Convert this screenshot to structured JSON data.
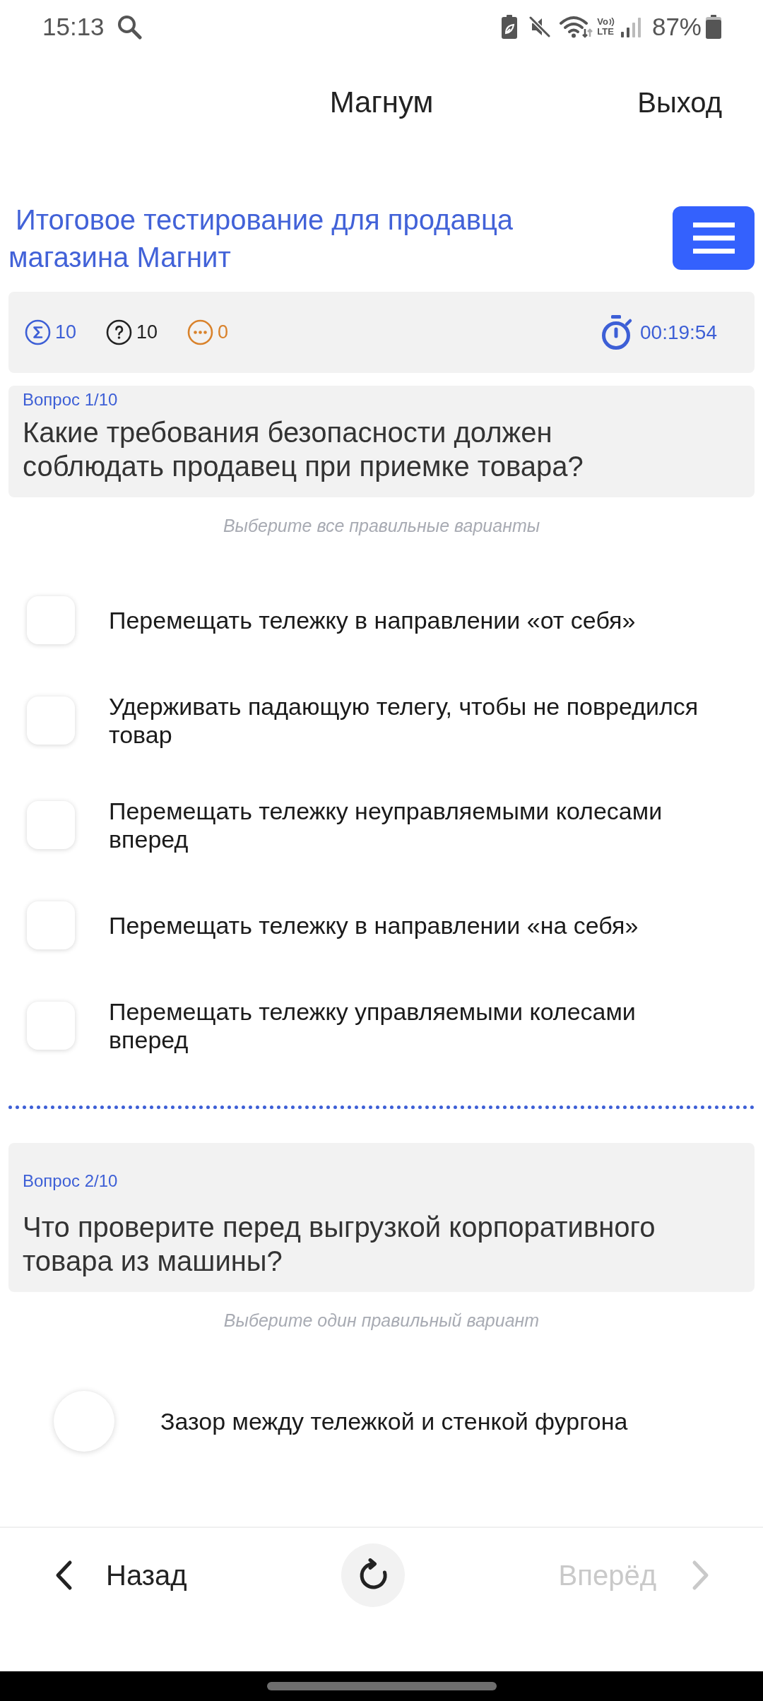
{
  "status_bar": {
    "time": "15:13",
    "volte": [
      "Vo",
      "LTE"
    ],
    "battery": "87%"
  },
  "header": {
    "title": "Магнум",
    "exit": "Выход"
  },
  "test": {
    "title": "Итоговое тестирование для продавца магазина Магнит"
  },
  "stats": {
    "items": [
      {
        "kind": "total",
        "value": "10",
        "color": "#3d5fd6"
      },
      {
        "kind": "questions",
        "value": "10",
        "color": "#222222"
      },
      {
        "kind": "skipped",
        "value": "0",
        "color": "#d9822b"
      }
    ],
    "timer": "00:19:54"
  },
  "questions": [
    {
      "label": "Вопрос 1/10",
      "text": "Какие требования безопасности должен соблюдать продавец при приемке товара?",
      "hint": "Выберите все правильные варианты",
      "kind": "multiple",
      "options": [
        {
          "text": "Перемещать тележку в направлении «от себя»",
          "checked": false
        },
        {
          "text": "Удерживать падающую телегу, чтобы не повредился товар",
          "checked": false
        },
        {
          "text": "Перемещать тележку неуправляемыми колесами вперед",
          "checked": false
        },
        {
          "text": "Перемещать тележку в направлении «на себя»",
          "checked": false
        },
        {
          "text": "Перемещать тележку управляемыми колесами вперед",
          "checked": false
        }
      ]
    },
    {
      "label": "Вопрос 2/10",
      "text": "Что проверите перед выгрузкой корпоративного товара из машины?",
      "hint": "Выберите один правильный вариант",
      "kind": "single",
      "options": [
        {
          "text": "Зазор между тележкой и стенкой фургона",
          "selected": false
        }
      ]
    }
  ],
  "nav": {
    "back": {
      "label": "Назад",
      "disabled": false
    },
    "forward": {
      "label": "Вперёд",
      "disabled": true
    }
  }
}
